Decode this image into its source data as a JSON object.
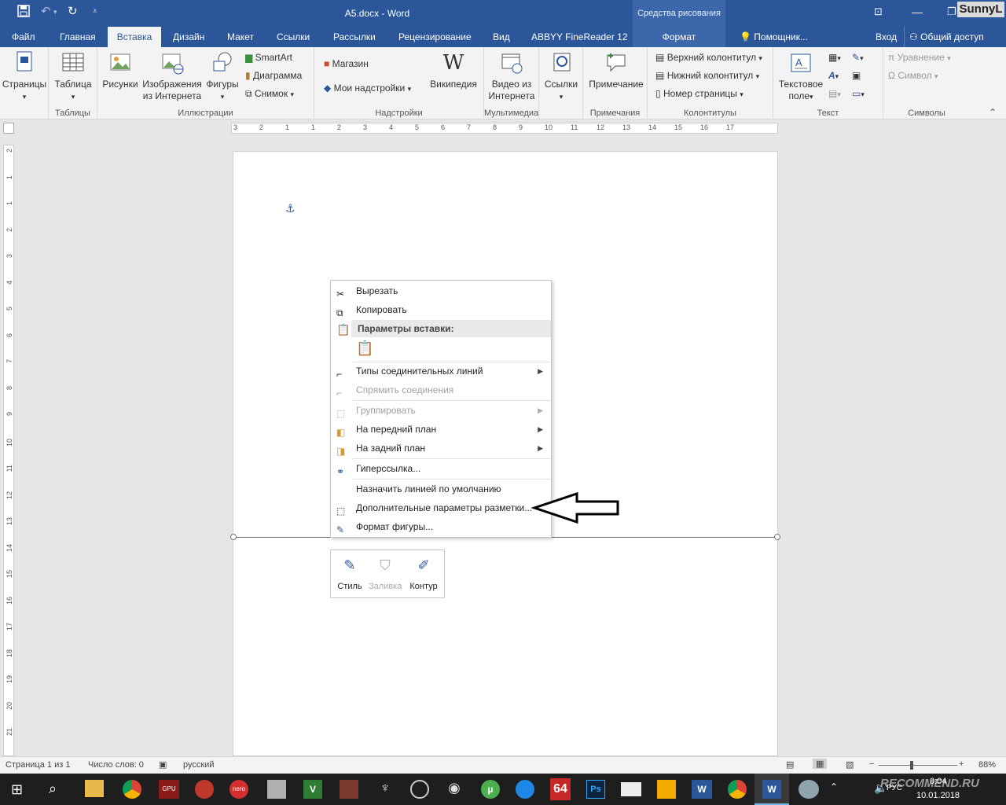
{
  "window": {
    "title": "A5.docx - Word",
    "context_group": "Средства рисования",
    "user": "SunnyL"
  },
  "tabs": [
    "Файл",
    "Главная",
    "Вставка",
    "Дизайн",
    "Макет",
    "Ссылки",
    "Рассылки",
    "Рецензирование",
    "Вид",
    "ABBYY FineReader 12",
    "Формат"
  ],
  "tell_me": "Помощник...",
  "signin": "Вход",
  "share": "Общий доступ",
  "ribbon": {
    "pages": {
      "line1": "Страницы",
      "line2": ""
    },
    "tables": {
      "label": "Таблица",
      "group": "Таблицы"
    },
    "illustrations": {
      "pictures": "Рисунки",
      "online_pictures_1": "Изображения",
      "online_pictures_2": "из Интернета",
      "shapes": "Фигуры",
      "smartart": "SmartArt",
      "chart": "Диаграмма",
      "screenshot": "Снимок",
      "group": "Иллюстрации"
    },
    "addins": {
      "store": "Магазин",
      "my_addins": "Мои надстройки",
      "wikipedia": "Википедия",
      "group": "Надстройки"
    },
    "media": {
      "video_1": "Видео из",
      "video_2": "Интернета",
      "group": "Мультимедиа"
    },
    "links": {
      "label": "Ссылки"
    },
    "comments": {
      "label": "Примечание",
      "group": "Примечания"
    },
    "headerfooter": {
      "header": "Верхний колонтитул",
      "footer": "Нижний колонтитул",
      "page_number": "Номер страницы",
      "group": "Колонтитулы"
    },
    "text": {
      "textbox_1": "Текстовое",
      "textbox_2": "поле",
      "group": "Текст"
    },
    "symbols": {
      "equation": "Уравнение",
      "symbol": "Символ",
      "group": "Символы"
    }
  },
  "ruler": {
    "h_ticks": [
      "3",
      "2",
      "1",
      "1",
      "2",
      "3",
      "4",
      "5",
      "6",
      "7",
      "8",
      "9",
      "10",
      "11",
      "12",
      "13",
      "14",
      "15",
      "16",
      "17"
    ],
    "v_ticks": [
      "2",
      "1",
      "1",
      "2",
      "3",
      "4",
      "5",
      "6",
      "7",
      "8",
      "9",
      "10",
      "11",
      "12",
      "13",
      "14",
      "15",
      "16",
      "17",
      "18",
      "19",
      "20",
      "21"
    ]
  },
  "context_menu": {
    "cut": "Вырезать",
    "copy": "Копировать",
    "paste_options": "Параметры вставки:",
    "connector_types": "Типы соединительных линий",
    "straighten": "Спрямить соединения",
    "group": "Группировать",
    "bring_front": "На передний план",
    "send_back": "На задний план",
    "hyperlink": "Гиперссылка...",
    "default_line": "Назначить линией по умолчанию",
    "more_layout": "Дополнительные параметры разметки...",
    "format_shape": "Формат фигуры..."
  },
  "mini_toolbar": {
    "style": "Стиль",
    "fill": "Заливка",
    "outline": "Контур"
  },
  "status": {
    "page": "Страница 1 из 1",
    "words": "Число слов: 0",
    "lang": "русский",
    "zoom": "88%"
  },
  "taskbar": {
    "lang": "РУС",
    "time": "0:04",
    "date": "10.01.2018",
    "watermark": "RECOMMEND.RU",
    "badge": "64"
  },
  "colors": {
    "accent": "#2b579a",
    "paste_header_bg": "#e9e9e9"
  }
}
